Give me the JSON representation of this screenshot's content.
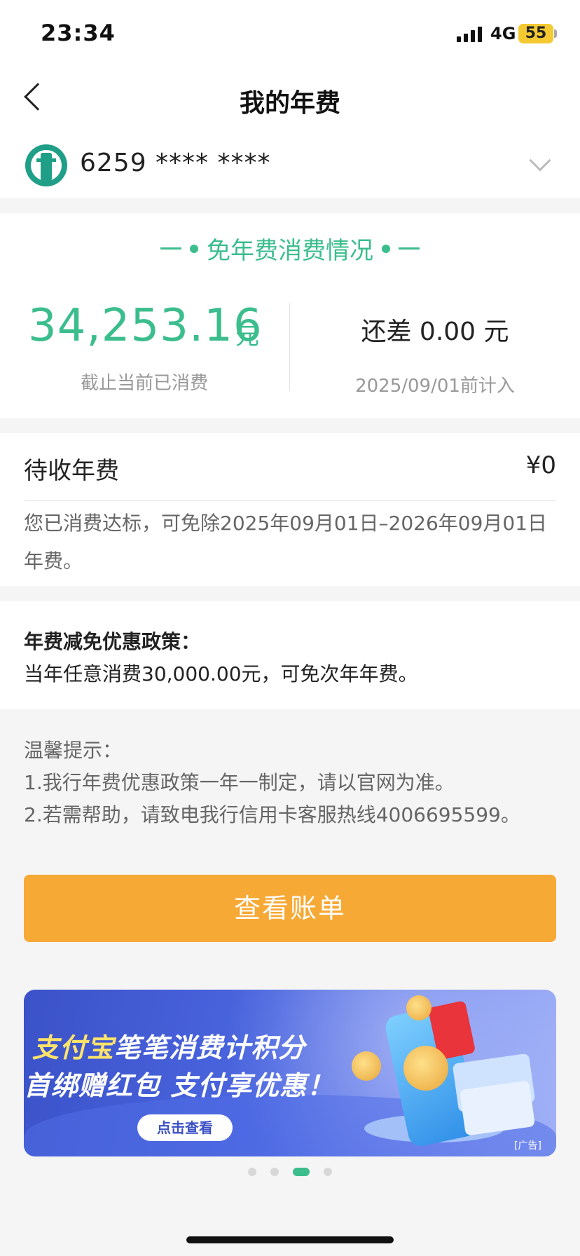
{
  "status_bar": {
    "time": "23:34",
    "network": "4G",
    "battery": "55",
    "icons": [
      "signal-icon",
      "battery-icon"
    ]
  },
  "nav": {
    "title": "我的年费",
    "back_icon": "back-arrow-icon"
  },
  "card": {
    "number": "6259 **** ****",
    "icons": [
      "bank-logo-icon",
      "chevron-down-icon"
    ]
  },
  "stats": {
    "title": "免年费消费情况",
    "spent_amount": "34,253.16",
    "spent_unit": "元",
    "spent_label": "截止当前已消费",
    "remaining": "还差 0.00 元",
    "deadline_label": "2025/09/01前计入"
  },
  "pending": {
    "label": "待收年费",
    "value": "¥0",
    "note": "您已消费达标，可免除2025年09月01日–2026年09月01日年费。"
  },
  "policy": {
    "title": "年费减免优惠政策：",
    "text": "当年任意消费30,000.00元，可免次年年费。"
  },
  "tips": {
    "title": "温馨提示：",
    "line1": "1.我行年费优惠政策一年一制定，请以官网为准。",
    "line2": "2.若需帮助，请致电我行信用卡客服热线4006695599。"
  },
  "bill_button": {
    "label": "查看账单"
  },
  "banner": {
    "line1_highlight": "支付宝",
    "line1_rest": "笔笔消费计积分",
    "line2": "首绑赠红包 支付享优惠！",
    "cta": "点击查看",
    "ad_tag": "[广告]",
    "carousel_count": 4,
    "active_index": 2
  },
  "colors": {
    "accent_green": "#3bbd8d",
    "button_orange": "#f7a935",
    "banner_blue": "#4b66e0"
  }
}
